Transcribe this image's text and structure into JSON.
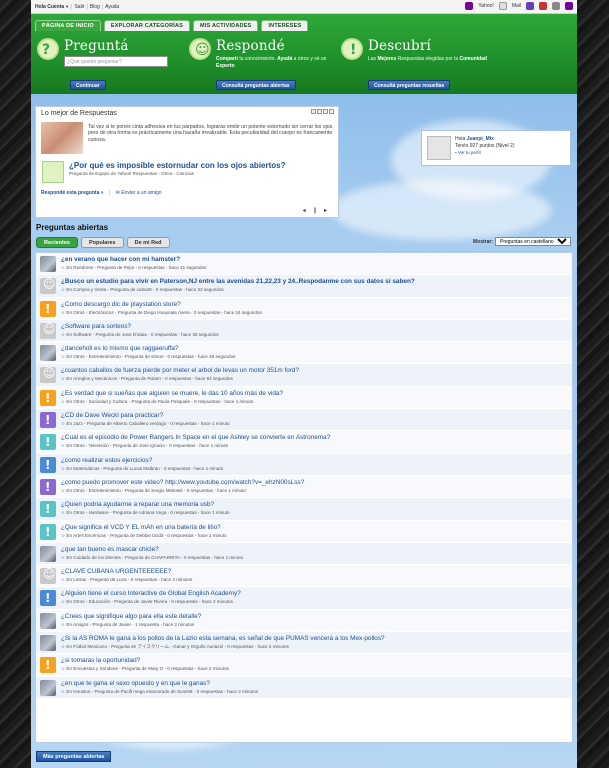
{
  "topbar": {
    "greeting": "Hola Cuenta",
    "links": [
      "Salir",
      "Blog",
      "Ayuda"
    ],
    "right": [
      "Yahoo!",
      "Mail"
    ]
  },
  "tabs": [
    "PÁGINA DE INICIO",
    "EXPLORAR CATEGORÍAS",
    "MIS ACTIVIDADES",
    "INTERESES"
  ],
  "header": {
    "ask": {
      "title": "Preguntá",
      "placeholder": "¿Qué querés preguntar?",
      "button": "Continuar"
    },
    "answer": {
      "title": "Respondé",
      "desc_b1": "Compartí",
      "desc1": " tu conocimiento. ",
      "desc_b2": "Ayudá",
      "desc2": " a otros y sé un ",
      "desc_b3": "Experto",
      "button": "Consultá preguntas abiertas"
    },
    "discover": {
      "title": "Descubrí",
      "desc_pre": "Las ",
      "desc_b": "Mejores",
      "desc_post": " Respuestas elegidas por la ",
      "desc_b2": "Comunidad",
      "button": "Consultá preguntas resueltas"
    }
  },
  "best": {
    "title": "Lo mejor de Respuestas",
    "text": "Tal vez si te ponés cinta adhesiva en tus párpados, lograrás emitir un potente estornudo sin cerrar los ojos, pero de otra forma es prácticamente una hazaña irrealizable. Esta peculiaridad del cuerpo es francamente curiosa.",
    "question": "¿Por qué es imposible estornudar con los ojos abiertos?",
    "meta": "Pregunta de Equipo de Yahoo! Respuestas - Otros - Ciencias",
    "answer_link": "Respondé esta pregunta »",
    "send": "Enviar a un amigo"
  },
  "user": {
    "hello": "Hola",
    "name": "Juanpi_Mix",
    "points": "Tenés 927 puntos (Nivel 2)",
    "profile": "Ver tu perfil"
  },
  "open": {
    "title": "Preguntas abiertas",
    "tabs": [
      "Recientes",
      "Populares",
      "De mi Red"
    ],
    "show_label": "Mostrar:",
    "show_value": "Preguntas en castellano",
    "more": "Más preguntas abiertas",
    "questions": [
      {
        "t": "¿en verano que hacer con mi hamster?",
        "m": "En Roedores - Pregunta de Pepo - 0 respuestas - hace 31 segundos",
        "icon": "photo",
        "bold": true
      },
      {
        "t": "¿Busco un estudio para vivir en Paterson,NJ entre las avenidas 21,22,23 y 24..Respodanme con sus datos si saben?",
        "m": "En Compra y Venta - Pregunta de cuba28 - 0 respuestas - hace 33 segundos",
        "icon": "g",
        "bold": true
      },
      {
        "t": "¿Como descargo dlc de playstation store?",
        "m": "En Otros - Electrónicos - Pregunta de Diego Huaynate rivera - 0 respuestas - hace 34 segundos",
        "icon": "o"
      },
      {
        "t": "¿Software para sorteos?",
        "m": "En Software - Pregunta de Jose D'alaia - 0 respuestas - hace 38 segundos",
        "icon": "g"
      },
      {
        "t": "¿danceholl es lo mismo que raggaeruffa?",
        "m": "En Otros - Entretenimiento - Pregunta de simon - 0 respuestas - hace 46 segundos",
        "icon": "photo"
      },
      {
        "t": "¿cuantos caballos de fuerza pierde por meter el arbol de levas un motor 351m ford?",
        "m": "En Arreglos y Mecánicos - Pregunta de Ruben - 0 respuestas - hace 54 segundos",
        "icon": "g"
      },
      {
        "t": "¿Es verdad que si sueñas que alguien se muere, le das 10 años más de vida?",
        "m": "En Otros - Sociedad y Cultura - Pregunta de Paula Pasquale - 0 respuestas - hace 1 minuto",
        "icon": "o"
      },
      {
        "t": "¿CD de Dave Weckl para practicar?",
        "m": "En Jazz - Pregunta de Alberto Caballero verdugo - 0 respuestas - hace 1 minuto",
        "icon": "p"
      },
      {
        "t": "¿Cual es el episodio de Power Rangers In Space en el que Ashley se convierte en Astronema?",
        "m": "En Otros - Televisión - Pregunta de Jose Ignacio - 0 respuestas - hace 1 minuto",
        "icon": "t"
      },
      {
        "t": "¿como realizar estos ejercicios?",
        "m": "En Matemáticas - Pregunta de Lucas Malbran - 0 respuestas - hace 1 minuto",
        "icon": "b"
      },
      {
        "t": "¿como puedo promover este video? http://www.youtube.com/watch?v=_ehzN00sLss?",
        "m": "En Otros - Entretenimiento - Pregunta de Sergio Mistoteli - 0 respuestas - hace 1 minuto",
        "icon": "p"
      },
      {
        "t": "¿Quien podria ayudarme a reparar una memoria usb?",
        "m": "En Otros - Hardware - Pregunta de Adriana Vega - 0 respuestas - hace 1 minuto",
        "icon": "t"
      },
      {
        "t": "¿Que significa el VCD Y EL mAh en una batería de litio?",
        "m": "En Artes Escénicas - Pregunta de Debbie Dodd - 0 respuestas - hace 1 minuto",
        "icon": "t"
      },
      {
        "t": "¿que tan bueno es mascar chicle?",
        "m": "En Cuidado de los Dientes - Pregunta de CHAPARRITA - 0 respuestas - hace 1 minuto",
        "icon": "photo"
      },
      {
        "t": "¿CLAVE CUBANA URGENTEEEEEE?",
        "m": "En Letras - Pregunta de Luna - 0 respuestas - hace 2 minutos",
        "icon": "g"
      },
      {
        "t": "¿Alguien tiene el curso Interactive de Global English Academy?",
        "m": "En Otros - Educación - Pregunta de Javier Rivera - 0 respuestas - hace 2 minutos",
        "icon": "b"
      },
      {
        "t": "¿Crees que signifique algo para ella este detalle?",
        "m": "En Amigos - Pregunta de Javier - 1 respuesta - hace 2 minutos",
        "icon": "photo"
      },
      {
        "t": "¿Si la AS ROMA le gana a los pollos de la Lazio esta semana, es señal de que PUMAS vencerá a los Mex-pollos?",
        "m": "En Fútbol Mexicano - Pregunta de アイスクリーム - Ganar y Orgullo Auriazul - 0 respuestas - hace 2 minutos",
        "icon": "photo"
      },
      {
        "t": "¿si tomaras la oportunidad?",
        "m": "En Encuestas y Sondeos - Pregunta de Mary G - 0 respuestas - hace 2 minutos",
        "icon": "o"
      },
      {
        "t": "¿en que te gana el sexo opuesto y en que le ganas?",
        "m": "En Houston - Pregunta de Pacifi mega enamorado de Scarlett - 0 respuestas - hace 2 minutos",
        "icon": "photo"
      }
    ]
  }
}
